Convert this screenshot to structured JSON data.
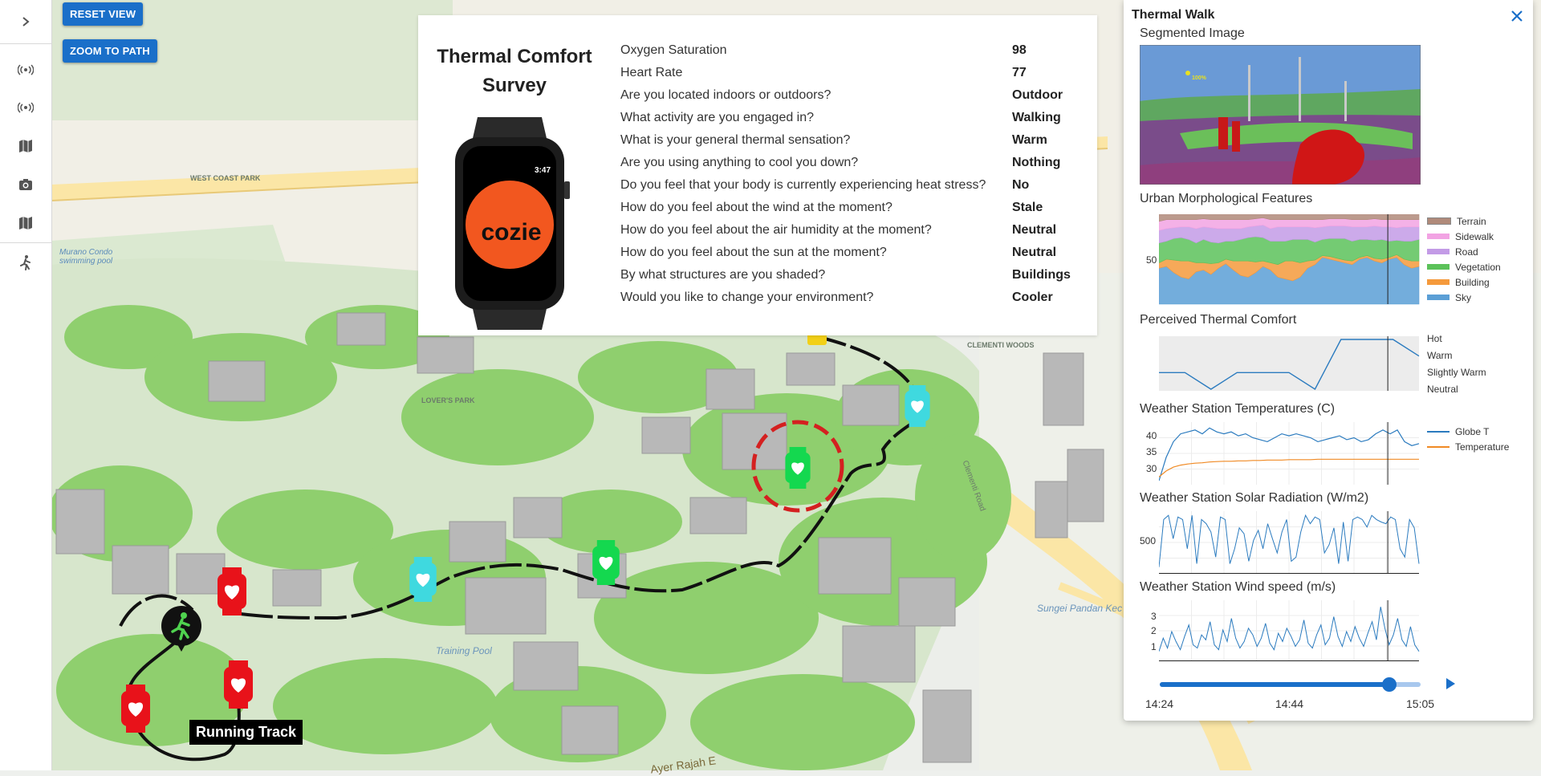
{
  "toolbar": {
    "reset_view": "RESET VIEW",
    "zoom_to_path": "ZOOM TO PATH"
  },
  "sidebar": {
    "toggle_icon": "chevron-right-icon",
    "items": [
      {
        "icon": "sensor-icon"
      },
      {
        "icon": "sensor-icon"
      },
      {
        "icon": "map-icon"
      },
      {
        "icon": "camera-icon"
      },
      {
        "icon": "map-icon"
      },
      {
        "icon": "walking-person-icon"
      }
    ]
  },
  "map": {
    "labels": {
      "west_coast_park": "WEST COAST PARK",
      "murano": "Murano Condo swimming pool",
      "clementi_woods": "CLEMENTI WOODS",
      "lovers_park": "LOVER'S PARK",
      "training_pool": "Training Pool",
      "sungei": "Sungei Pandan Kec",
      "clementi_road": "Clementi Road",
      "ayer_rajah": "Ayer Rajah E"
    },
    "running_track": "Running Track",
    "watch_colors": {
      "red": "#e8121a",
      "cyan": "#3fd9df",
      "green": "#14d84f",
      "yellow": "#f2d017"
    }
  },
  "survey": {
    "title_line1": "Thermal Comfort",
    "title_line2": "Survey",
    "watch_time": "3:47",
    "watch_brand": "cozie",
    "rows": [
      {
        "q": "Oxygen Saturation",
        "a": "98"
      },
      {
        "q": "Heart Rate",
        "a": "77"
      },
      {
        "q": "Are you located indoors or outdoors?",
        "a": "Outdoor"
      },
      {
        "q": "What activity are you engaged in?",
        "a": "Walking"
      },
      {
        "q": "What is your general thermal sensation?",
        "a": "Warm"
      },
      {
        "q": "Are you using anything to cool you down?",
        "a": "Nothing"
      },
      {
        "q": "Do you feel that your body is currently experiencing heat stress?",
        "a": "No"
      },
      {
        "q": "How do you feel about the wind at the moment?",
        "a": "Stale"
      },
      {
        "q": "How do you feel about the air humidity at the moment?",
        "a": "Neutral"
      },
      {
        "q": "How do you feel about the sun at the moment?",
        "a": "Neutral"
      },
      {
        "q": "By what structures are you shaded?",
        "a": "Buildings"
      },
      {
        "q": "Would you like to change your environment?",
        "a": "Cooler"
      }
    ]
  },
  "panel": {
    "title": "Thermal Walk",
    "close_icon": "close-icon",
    "segmented_title": "Segmented Image",
    "seg_overlay_text": "100%",
    "morph_title": "Urban Morphological Features",
    "morph_ytick": "50",
    "morph_legend": [
      {
        "name": "Terrain",
        "color": "#b08a7a"
      },
      {
        "name": "Sidewalk",
        "color": "#f2a3e3"
      },
      {
        "name": "Road",
        "color": "#c39be6"
      },
      {
        "name": "Vegetation",
        "color": "#5cc25a"
      },
      {
        "name": "Building",
        "color": "#f59a3c"
      },
      {
        "name": "Sky",
        "color": "#5b9fd6"
      }
    ],
    "comfort_title": "Perceived Thermal Comfort",
    "comfort_categories": [
      "Hot",
      "Warm",
      "Slightly Warm",
      "Neutral"
    ],
    "temp_title": "Weather Station Temperatures (C)",
    "temp_yticks": [
      "40",
      "35",
      "30"
    ],
    "temp_legend": [
      {
        "name": "Globe T",
        "color": "#2b7bbf"
      },
      {
        "name": "Temperature",
        "color": "#f08a24"
      }
    ],
    "solar_title": "Weather Station Solar Radiation (W/m2)",
    "solar_ytick": "500",
    "wind_title": "Weather Station Wind speed (m/s)",
    "wind_yticks": [
      "3",
      "2",
      "1"
    ],
    "time_labels": [
      "14:24",
      "14:44",
      "15:05"
    ],
    "slider_position": 0.88,
    "play_icon": "play-icon"
  },
  "chart_data": [
    {
      "type": "area",
      "title": "Urban Morphological Features",
      "ylim": [
        0,
        100
      ],
      "series": [
        {
          "name": "Sky",
          "values": [
            40,
            42,
            35,
            30,
            28,
            36,
            38,
            33,
            40,
            45,
            38,
            32,
            30,
            35,
            42,
            38,
            30,
            28,
            26,
            30,
            40,
            44,
            52,
            50,
            48,
            46,
            44,
            50,
            52,
            48,
            46,
            50,
            52,
            44,
            40,
            42
          ]
        },
        {
          "name": "Building",
          "values": [
            6,
            8,
            14,
            18,
            20,
            10,
            8,
            12,
            6,
            5,
            10,
            16,
            18,
            12,
            6,
            8,
            14,
            20,
            22,
            16,
            8,
            5,
            2,
            3,
            3,
            3,
            4,
            2,
            2,
            3,
            4,
            2,
            3,
            6,
            8,
            6
          ]
        },
        {
          "name": "Vegetation",
          "values": [
            22,
            20,
            24,
            26,
            24,
            22,
            26,
            24,
            22,
            20,
            22,
            24,
            26,
            28,
            26,
            24,
            26,
            22,
            24,
            26,
            24,
            20,
            18,
            20,
            22,
            24,
            22,
            20,
            18,
            20,
            22,
            18,
            16,
            20,
            22,
            24
          ]
        },
        {
          "name": "Road",
          "values": [
            14,
            14,
            12,
            12,
            14,
            16,
            14,
            16,
            16,
            14,
            14,
            12,
            12,
            12,
            14,
            14,
            16,
            16,
            14,
            14,
            14,
            16,
            14,
            14,
            14,
            14,
            16,
            14,
            14,
            16,
            14,
            16,
            14,
            16,
            16,
            14
          ]
        },
        {
          "name": "Sidewalk",
          "values": [
            10,
            10,
            9,
            8,
            8,
            10,
            9,
            9,
            10,
            10,
            10,
            10,
            8,
            8,
            8,
            10,
            8,
            8,
            8,
            8,
            8,
            9,
            8,
            8,
            8,
            8,
            8,
            8,
            8,
            8,
            8,
            8,
            9,
            8,
            8,
            8
          ]
        },
        {
          "name": "Terrain",
          "values": [
            8,
            6,
            6,
            6,
            6,
            6,
            5,
            6,
            6,
            6,
            6,
            6,
            6,
            5,
            4,
            6,
            6,
            6,
            6,
            6,
            6,
            6,
            6,
            5,
            5,
            5,
            6,
            6,
            6,
            5,
            6,
            6,
            6,
            6,
            6,
            6
          ]
        }
      ]
    },
    {
      "type": "line",
      "title": "Perceived Thermal Comfort",
      "categories": [
        "Neutral",
        "Slightly Warm",
        "Warm",
        "Hot"
      ],
      "values": [
        "Slightly Warm",
        "Slightly Warm",
        "Neutral",
        "Slightly Warm",
        "Slightly Warm",
        "Slightly Warm",
        "Neutral",
        "Hot",
        "Hot",
        "Hot",
        "Warm"
      ]
    },
    {
      "type": "line",
      "title": "Weather Station Temperatures (C)",
      "ylim": [
        27,
        43
      ],
      "series": [
        {
          "name": "Globe T",
          "values": [
            28,
            34,
            38,
            40,
            40.5,
            41,
            40,
            41.5,
            40.5,
            40,
            40.5,
            39.5,
            40,
            39,
            38.5,
            38,
            39,
            40,
            39.5,
            40,
            39.5,
            39,
            38,
            38.5,
            39,
            39.5,
            38.5,
            39,
            38,
            38.5,
            40,
            41,
            40,
            41,
            38,
            37,
            37.5
          ]
        },
        {
          "name": "Temperature",
          "values": [
            29,
            30.5,
            31.5,
            32,
            32.3,
            32.5,
            32.6,
            32.8,
            32.9,
            33,
            33,
            33.1,
            33.1,
            33.2,
            33.2,
            33.3,
            33.3,
            33.3,
            33.4,
            33.4,
            33.4,
            33.4,
            33.5,
            33.5,
            33.5,
            33.5,
            33.5,
            33.5,
            33.5,
            33.5,
            33.5,
            33.5,
            33.5,
            33.5,
            33.5,
            33.5,
            33.5
          ]
        }
      ]
    },
    {
      "type": "line",
      "title": "Weather Station Solar Radiation (W/m2)",
      "ylim": [
        0,
        750
      ],
      "series": [
        {
          "name": "",
          "values": [
            80,
            650,
            700,
            420,
            680,
            650,
            300,
            700,
            120,
            650,
            600,
            500,
            200,
            680,
            650,
            120,
            300,
            550,
            480,
            150,
            400,
            520,
            300,
            600,
            420,
            250,
            500,
            650,
            150,
            200,
            500,
            700,
            600,
            680,
            650,
            250,
            350,
            550,
            120,
            620,
            150,
            650,
            680,
            650,
            560,
            700,
            650,
            620,
            600,
            680,
            650,
            300,
            200,
            650,
            550,
            120
          ]
        }
      ]
    },
    {
      "type": "line",
      "title": "Weather Station Wind speed (m/s)",
      "ylim": [
        0,
        3.7
      ],
      "series": [
        {
          "name": "",
          "values": [
            0.6,
            1.4,
            0.8,
            1.8,
            1.2,
            0.7,
            1.5,
            2.2,
            1.0,
            0.8,
            1.6,
            1.3,
            2.4,
            1.0,
            0.7,
            1.9,
            1.2,
            2.6,
            1.4,
            0.8,
            1.2,
            2.0,
            1.6,
            0.9,
            1.4,
            2.3,
            1.1,
            0.7,
            1.7,
            1.2,
            2.0,
            1.5,
            0.9,
            1.3,
            2.5,
            1.1,
            0.8,
            1.6,
            2.2,
            1.0,
            1.4,
            2.7,
            1.5,
            0.9,
            1.8,
            1.2,
            2.1,
            1.4,
            0.9,
            1.7,
            2.4,
            1.3,
            3.3,
            2.0,
            1.0,
            1.6,
            2.6,
            1.3,
            0.9,
            2.1,
            1.0,
            0.6
          ]
        }
      ]
    }
  ]
}
